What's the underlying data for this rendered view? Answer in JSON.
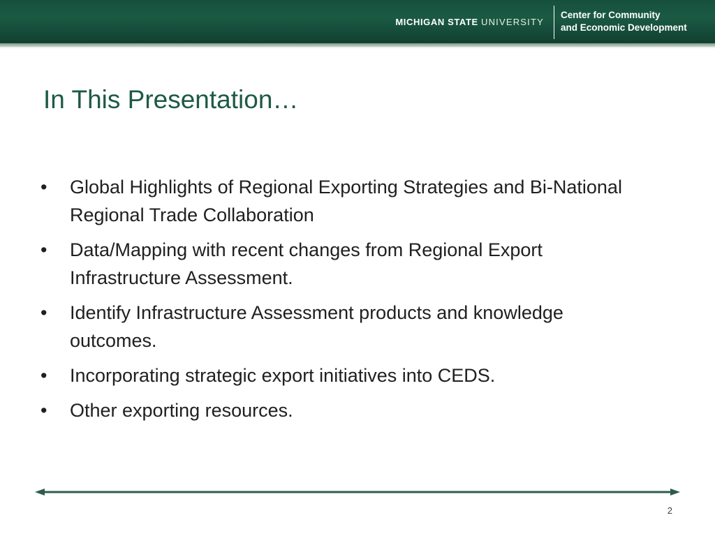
{
  "header": {
    "university_bold": "MICHIGAN STATE",
    "university_light": "UNIVERSITY",
    "center_line1": "Center for Community",
    "center_line2": "and Economic Development"
  },
  "slide": {
    "title": "In This Presentation…",
    "bullets": [
      "Global Highlights of Regional Exporting Strategies and Bi-National Regional Trade Collaboration",
      "Data/Mapping with recent changes from Regional Export Infrastructure Assessment.",
      "Identify Infrastructure Assessment products and knowledge outcomes.",
      "Incorporating strategic export initiatives into CEDS.",
      "Other exporting resources."
    ],
    "bullet_symbol": "•",
    "page_number": "2"
  },
  "colors": {
    "header_green": "#1a5a43",
    "title_green": "#1d5a45",
    "body_text": "#202020"
  }
}
